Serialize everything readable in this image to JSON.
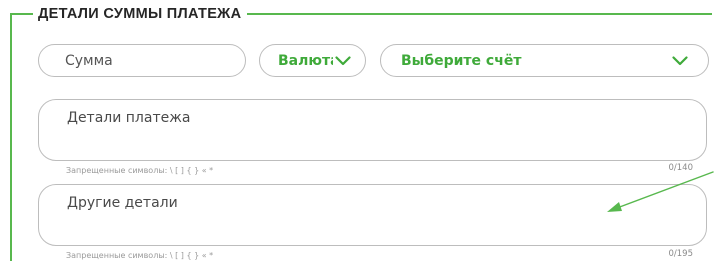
{
  "section": {
    "title": "ДЕТАЛИ СУММЫ ПЛАТЕЖА"
  },
  "fields": {
    "amount_placeholder": "Сумма",
    "currency_label": "Валюта",
    "currency_icon": "chevron-down-icon",
    "account_placeholder": "Выберите счёт",
    "account_icon": "chevron-down-icon",
    "payment_details_placeholder": "Детали платежа",
    "payment_details_hint": "Запрещенные символы: \\ [ ] { } « *",
    "payment_details_counter": "0/140",
    "other_details_placeholder": "Другие детали",
    "other_details_hint": "Запрещенные символы: \\ [ ] { } « *",
    "other_details_counter": "0/195"
  },
  "colors": {
    "accent": "#3faa3a",
    "frame": "#58b84e",
    "border": "#bdbdbd",
    "annotation_arrow": "#58b84e"
  }
}
